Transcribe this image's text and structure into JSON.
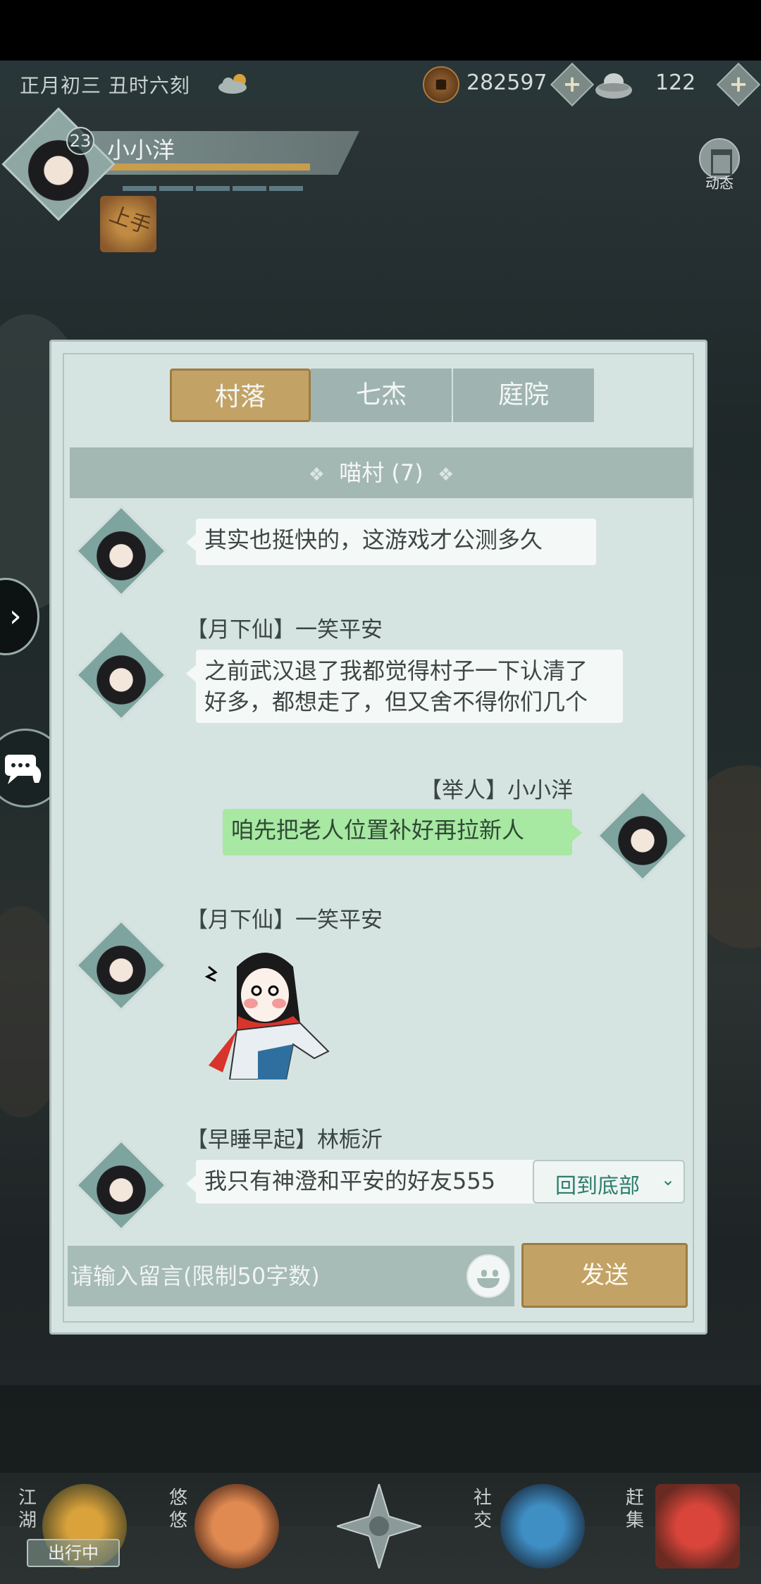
{
  "header": {
    "date": "正月初三  丑时六刻",
    "coins": "282597",
    "silver": "122",
    "plus": "+"
  },
  "player": {
    "level": "23",
    "name": "小小洋",
    "item_char": "上手",
    "dynamic_label": "动态"
  },
  "side": {
    "expand": "›"
  },
  "tabs": [
    {
      "label": "村落",
      "active": true
    },
    {
      "label": "七杰",
      "active": false
    },
    {
      "label": "庭院",
      "active": false
    }
  ],
  "channel": {
    "title": "喵村 (7)",
    "ornament": "❖"
  },
  "messages": [
    {
      "sender": "",
      "text": "其实也挺快的，这游戏才公测多久"
    },
    {
      "sender": "【月下仙】一笑平安",
      "text_lines": [
        "之前武汉退了我都觉得村子一下认清了",
        "好多，都想走了，但又舍不得你们几个"
      ]
    },
    {
      "sender": "【举人】小小洋",
      "text": "咱先把老人位置补好再拉新人",
      "mine": true
    },
    {
      "sender": "【月下仙】一笑平安",
      "sticker": true
    },
    {
      "sender": "【早睡早起】林栀沂",
      "text": "我只有神澄和平安的好友555"
    }
  ],
  "back_to_bottom": {
    "label": "回到底部",
    "chevron": "⌄"
  },
  "input": {
    "placeholder": "请输入留言(限制50字数)"
  },
  "send_label": "发送",
  "bottom_nav": {
    "jianghu": "江湖",
    "youyou": "悠悠",
    "shejiao": "社交",
    "ganji": "赶集",
    "status_tag": "出行中"
  }
}
